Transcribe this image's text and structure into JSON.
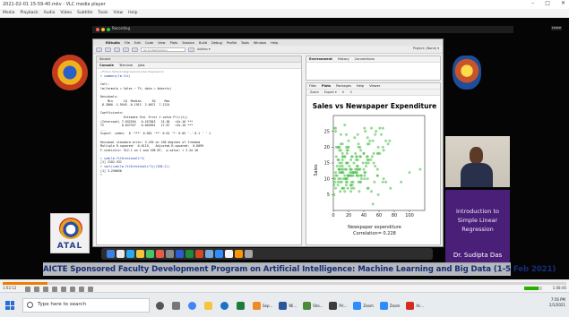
{
  "window": {
    "title": "2021-02-01 15-59-40.mkv - VLC media player",
    "controls": [
      "–",
      "□",
      "✕"
    ],
    "menu": [
      "Media",
      "Playback",
      "Audio",
      "Video",
      "Subtitle",
      "Tools",
      "View",
      "Help"
    ]
  },
  "video": {
    "meeting_label": "Recording",
    "leave_label": "Leave",
    "rstudio": {
      "menu": [
        "RStudio",
        "File",
        "Edit",
        "Code",
        "View",
        "Plots",
        "Session",
        "Build",
        "Debug",
        "Profile",
        "Tools",
        "Window",
        "Help"
      ],
      "goto_placeholder": "Go to file/function",
      "addins_label": "Addins ▾",
      "project_label": "Project: (None) ▾",
      "console": {
        "header": "Source",
        "tabs": [
          "Console",
          "Terminal",
          "Jobs"
        ],
        "path": "~/Future Skills/AI Regression/Linear Regression/",
        "lines": [
          {
            "text": "> summary(lm.fit)",
            "cmd": true
          },
          {
            "text": "",
            "cmd": false
          },
          {
            "text": "Call:",
            "cmd": false
          },
          {
            "text": "lm(formula = Sales ~ TV, data = Adverts)",
            "cmd": false
          },
          {
            "text": "",
            "cmd": false
          },
          {
            "text": "Residuals:",
            "cmd": false
          },
          {
            "text": "    Min      1Q  Median      3Q     Max",
            "cmd": false
          },
          {
            "text": "-8.3860 -1.9545 -0.1913  2.0671  7.2124",
            "cmd": false
          },
          {
            "text": "",
            "cmd": false
          },
          {
            "text": "Coefficients:",
            "cmd": false
          },
          {
            "text": "             Estimate Std. Error t value Pr(>|t|)",
            "cmd": false
          },
          {
            "text": "(Intercept) 7.032594   0.457843   15.36   <2e-16 ***",
            "cmd": false
          },
          {
            "text": "TV          0.047537   0.002691   17.67   <2e-16 ***",
            "cmd": false
          },
          {
            "text": "---",
            "cmd": false
          },
          {
            "text": "Signif. codes:  0 '***' 0.001 '**' 0.01 '*' 0.05 '.' 0.1 ' ' 1",
            "cmd": false
          },
          {
            "text": "",
            "cmd": false
          },
          {
            "text": "Residual standard error: 3.259 on 198 degrees of freedom",
            "cmd": false
          },
          {
            "text": "Multiple R-squared:  0.6119,   Adjusted R-squared:  0.6099",
            "cmd": false
          },
          {
            "text": "F-statistic: 312.1 on 1 and 198 DF,  p-value: < 2.2e-16",
            "cmd": false
          },
          {
            "text": "",
            "cmd": false
          },
          {
            "text": "> sum(lm.fit$residuals^2)",
            "cmd": true
          },
          {
            "text": "[1] 2102.531",
            "cmd": false
          },
          {
            "text": "> sqrt(sum(lm.fit$residuals^2)/(200-2))",
            "cmd": true
          },
          {
            "text": "[1] 3.258656",
            "cmd": false
          },
          {
            "text": ">",
            "cmd": true
          }
        ]
      },
      "env_pane": {
        "tabs": [
          "Environment",
          "History",
          "Connections"
        ]
      },
      "files_pane": {
        "tabs": [
          "Files",
          "Plots",
          "Packages",
          "Help",
          "Viewer"
        ],
        "tools": [
          "Zoom",
          "Export ▾",
          "✕",
          "✎"
        ]
      }
    },
    "intro_text": "Introduction to Simple Linear Regression",
    "presenter_name": "Dr. Sudipta Das",
    "atal_label": "ATAL",
    "banner_text": "AICTE Sponsored Faculty Development Program on Artificial Intelligence: Machine Learning and Big Data (1-5 Feb 2021)"
  },
  "player": {
    "elapsed": "1:02:12",
    "remaining": "1:08:46",
    "progress": 0.08
  },
  "taskbar": {
    "search_placeholder": "Type here to search",
    "apps": [
      "",
      "",
      "",
      "",
      "",
      "",
      "Sep...",
      "Wi...",
      "Sho...",
      "Pri...",
      "Zoom",
      "Zoom",
      "Ac..."
    ],
    "tray_time": "7:56 PM",
    "tray_date": "2/1/2021"
  },
  "chart_data": {
    "type": "scatter",
    "title": "Sales vs Newspaper Expenditure",
    "xlabel": "Newspaper expenditure",
    "xlabel2": "Correlation= 0.228",
    "ylabel": "Sales",
    "xlim": [
      0,
      120
    ],
    "ylim": [
      0,
      30
    ],
    "xticks": [
      0,
      20,
      40,
      60,
      80,
      100
    ],
    "yticks": [
      5,
      10,
      15,
      20,
      25
    ],
    "point_color": "#4cbf4c",
    "x": [
      69,
      45,
      69,
      58,
      58,
      75,
      24,
      11,
      1,
      21,
      24,
      4,
      65,
      7,
      66,
      52,
      114,
      55,
      19,
      18,
      53,
      23,
      50,
      25,
      13,
      26,
      19,
      7,
      19,
      22,
      33,
      8,
      37,
      47,
      2,
      8,
      1,
      15,
      58,
      45,
      24,
      65,
      15,
      24,
      54,
      39,
      33,
      28,
      27,
      66,
      41,
      36,
      20,
      45,
      33,
      63,
      9,
      16,
      17,
      59,
      1,
      32,
      30,
      21,
      18,
      31,
      35,
      55,
      10,
      48,
      29,
      42,
      26,
      26,
      13,
      89,
      24,
      12,
      59,
      20,
      11,
      45,
      36,
      31,
      10,
      32,
      12,
      46,
      31,
      35,
      17,
      12,
      35,
      74,
      41,
      45,
      23,
      6,
      50,
      36,
      22,
      100,
      4,
      53,
      12,
      59,
      3,
      9,
      34,
      8,
      32,
      72,
      43,
      49,
      11,
      40,
      8,
      26,
      23,
      12,
      43,
      19,
      30,
      8,
      20,
      5,
      27,
      18,
      3,
      17,
      52,
      29,
      33,
      18,
      58,
      20,
      23,
      56,
      9,
      7,
      3,
      36,
      19,
      19,
      41,
      17,
      32,
      3,
      18,
      16,
      44,
      42,
      17,
      51,
      10,
      41,
      15,
      16,
      45,
      13,
      12,
      10,
      34,
      40,
      31,
      35,
      23,
      13,
      31,
      40,
      17,
      12,
      6,
      30,
      24,
      17,
      15,
      29,
      31,
      15,
      37,
      27,
      2,
      6,
      61,
      61,
      9,
      8,
      46,
      7,
      46,
      11,
      23,
      6,
      12,
      14,
      25,
      3,
      65,
      5
    ],
    "y": [
      22,
      10,
      9,
      18,
      13,
      7,
      12,
      13,
      5,
      11,
      9,
      17,
      9,
      10,
      19,
      22,
      13,
      24,
      11,
      15,
      18,
      13,
      6,
      17,
      10,
      12,
      15,
      16,
      19,
      13,
      21,
      12,
      10,
      21,
      10,
      13,
      26,
      11,
      11,
      16,
      17,
      20,
      17,
      13,
      9,
      15,
      11,
      23,
      15,
      10,
      11,
      9,
      22,
      21,
      20,
      24,
      6,
      13,
      24,
      18,
      8,
      24,
      16,
      14,
      18,
      11,
      9,
      14,
      19,
      22,
      18,
      12,
      9,
      11,
      17,
      9,
      7,
      14,
      5,
      11,
      12,
      23,
      11,
      14,
      21,
      16,
      12,
      16,
      13,
      17,
      13,
      7,
      20,
      22,
      12,
      17,
      11,
      16,
      26,
      17,
      12,
      12,
      20,
      15,
      21,
      20,
      7,
      9,
      6,
      20,
      14,
      21,
      14,
      16,
      15,
      13,
      13,
      12,
      16,
      7,
      15,
      7,
      12,
      15,
      20,
      11,
      7,
      9,
      25,
      9,
      2,
      13,
      9,
      19,
      11,
      11,
      8,
      25,
      10,
      20,
      11,
      19,
      20,
      11,
      10,
      10,
      13,
      26,
      10,
      10,
      17,
      25,
      15,
      17,
      12,
      26,
      6,
      10,
      7,
      13,
      16,
      24,
      13,
      18,
      12,
      13,
      8,
      12,
      17,
      18,
      8,
      18,
      8,
      17,
      11,
      20,
      27,
      12,
      11,
      17,
      11,
      12,
      9,
      9,
      26,
      18,
      14,
      19,
      15,
      13,
      7,
      9,
      6,
      20,
      17,
      7,
      8,
      12,
      26,
      14
    ]
  }
}
